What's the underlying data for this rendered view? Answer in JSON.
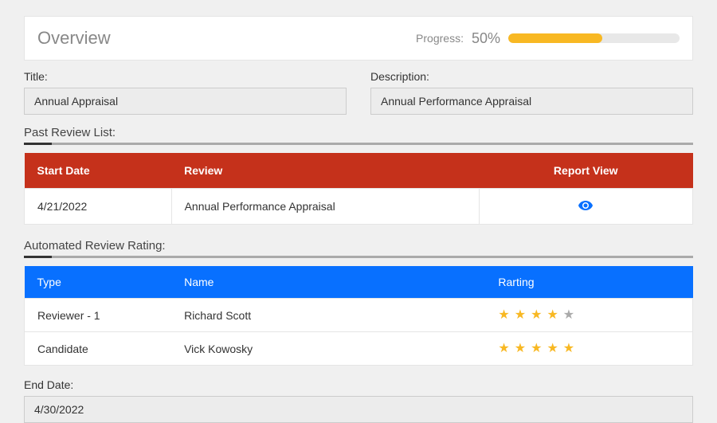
{
  "overview": {
    "title": "Overview",
    "progress_label": "Progress:",
    "progress_percent": "50%",
    "progress_fill_percent": 55
  },
  "form": {
    "title_label": "Title:",
    "title_value": "Annual Appraisal",
    "description_label": "Description:",
    "description_value": "Annual Performance Appraisal",
    "end_date_label": "End Date:",
    "end_date_value": "4/30/2022"
  },
  "past_review": {
    "section_title": "Past Review List:",
    "headers": {
      "start_date": "Start Date",
      "review": "Review",
      "report_view": "Report View"
    },
    "rows": [
      {
        "start_date": "4/21/2022",
        "review": "Annual Performance Appraisal"
      }
    ]
  },
  "rating_section": {
    "section_title": "Automated Review Rating:",
    "headers": {
      "type": "Type",
      "name": "Name",
      "rating": "Rarting"
    },
    "rows": [
      {
        "type": "Reviewer - 1",
        "name": "Richard Scott",
        "rating": 4
      },
      {
        "type": "Candidate",
        "name": "Vick Kowosky",
        "rating": 5
      }
    ]
  }
}
